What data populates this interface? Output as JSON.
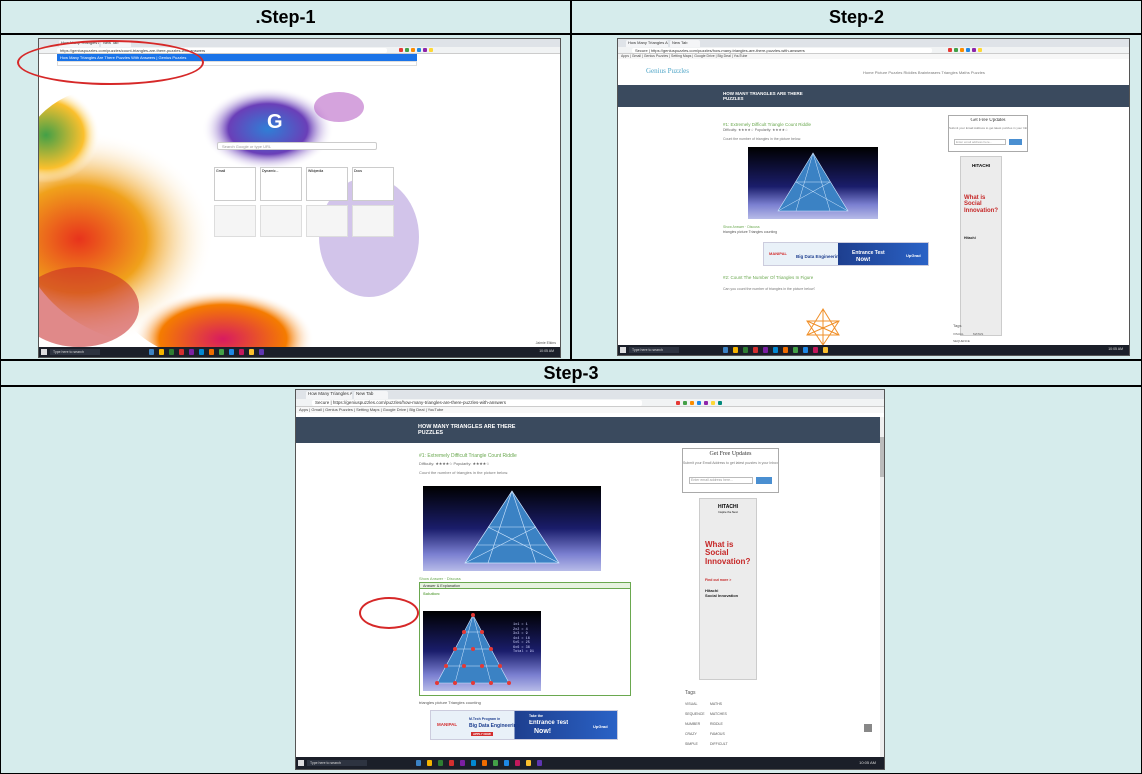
{
  "steps": {
    "step1_title": ".Step-1",
    "step2_title": "Step-2",
    "step3_title": "Step-3"
  },
  "browser": {
    "tab1_label": "How Many Triangles Are…",
    "tab2_label": "New Tab",
    "url_step1": "https://geniuspuzzles.com/puzzles/count-triangles-are-there-puzzles-with-answers",
    "suggest_step1": "How Many Triangles Are There Puzzles With Answers | Genius Puzzles",
    "url_step2": "Secure | https://geniuspuzzles.com/puzzles/how-many-triangles-are-there-puzzles-with-answers",
    "bookmarks": "Apps  | Gmail  | Genius Puzzles  | Setting Maps  | Google Drive  | Big Deal  | YouTube"
  },
  "newtab": {
    "search_placeholder": "Search Google or type URL",
    "tiles": [
      "Gmail",
      "Dynamic...",
      "Wikipedia",
      "Docs"
    ],
    "theme_credit": "Jaimie Elkins"
  },
  "site": {
    "logo": "Genius Puzzles",
    "nav": "Home   Picture Puzzles   Riddles   Brainteasers   Triangles   Maths Puzzles",
    "header_title_line1": "HOW MANY TRIANGLES ARE THERE",
    "header_title_line2": "PUZZLES",
    "post_title": "#1: Extremely Difficult Triangle Count Riddle",
    "post_meta": "Difficulty: ★★★★☆   Popularity: ★★★★☆",
    "post_desc": "Count the number of triangles in the picture below.",
    "post2_title": "#2: Count The Number Of Triangles In Figure",
    "post2_desc": "Can you count the number of triangles in the picture below?",
    "answer_link": "Show Answer",
    "discuss_link": "Discuss",
    "answer_section": "Answer & Explanation",
    "solution_label": "Solution:",
    "tags_line": "triangles    picture    Triangles counting",
    "tags_heading": "Tags",
    "tag_items": [
      "VISUAL",
      "MATHS",
      "SEQUENCE",
      "MATCHES",
      "NUMBER",
      "RIDDLE",
      "CRAZY",
      "FAMOUS",
      "SIMPLE",
      "DIFFICULT"
    ],
    "answer_values": [
      "1x1 = 1",
      "2x2 = 4",
      "3x3 = 9",
      "4x4 = 16",
      "5x5 = 25",
      "6x6 = 36",
      "Total = 91"
    ]
  },
  "sidebar": {
    "updates_title": "Get Free Updates",
    "updates_sub": "Submit your Email Address to get latest puzzles in your Inbox",
    "updates_placeholder": "Enter email address here...",
    "ad_brand": "HITACHI",
    "ad_tagline": "Inspire the Next",
    "ad_headline": "What is Social Innovation?",
    "ad_find": "Find out more >",
    "ad_brand2": "Hitachi",
    "ad_brand3": "Social Innovation"
  },
  "banner": {
    "logo": "MANIPAL",
    "program": "M.Tech Program in",
    "headline": "Big Data Engineering",
    "cta": "APPLY NOW",
    "right_small": "Take the",
    "right_big": "Entrance Test",
    "right_now": "Now!",
    "partner": "UpGrad"
  },
  "taskbar": {
    "search_text": "Type here to search",
    "time": "10:05 AM"
  },
  "colors": {
    "cell_bg": "#d6ecec",
    "highlight": "#d62828",
    "site_header": "#3a4a5e",
    "title_green": "#6aa84f"
  }
}
